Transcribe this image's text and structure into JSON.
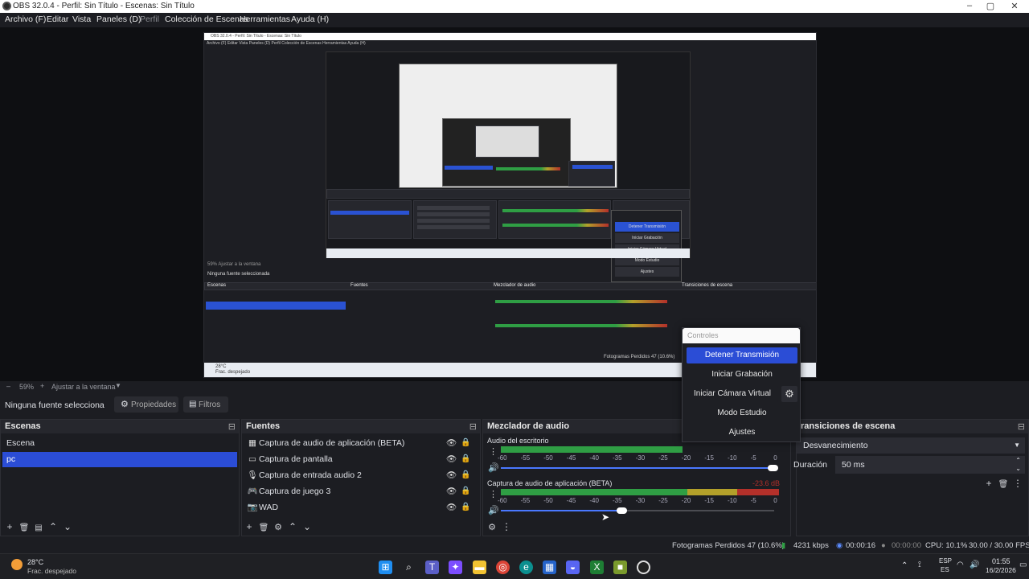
{
  "window": {
    "title": "OBS 32.0.4 - Perfil: Sin Título - Escenas: Sin Título",
    "controls": [
      "–",
      "▢",
      "✕"
    ]
  },
  "menu": [
    {
      "label": "Archivo (F)",
      "dim": false
    },
    {
      "label": "Editar",
      "dim": false
    },
    {
      "label": "Vista",
      "dim": false
    },
    {
      "label": "Paneles (D)",
      "dim": false
    },
    {
      "label": "Perfil",
      "dim": true
    },
    {
      "label": "Colección de Escenas",
      "dim": false
    },
    {
      "label": "Herramientas",
      "dim": false
    },
    {
      "label": "Ayuda (H)",
      "dim": false
    }
  ],
  "preview": {
    "nested_title": "OBS 32.0.4 - Perfil: Sin Título - Escenas: Sin Título",
    "nested_menu": "Archivo (F)   Editar   Vista   Paneles (D)   Perfil   Colección de Escenas   Herramientas   Ayuda (H)",
    "nested_status_left": "Ninguna fuente seleccionada",
    "nested_zoom": "59%   Ajustar a la ventana",
    "nested_scene_head": "Escenas",
    "nested_sources_head": "Fuentes",
    "nested_mixer_head": "Mezclador de audio",
    "nested_trans_head": "Transiciones de escena",
    "nested_weather_temp": "28°C",
    "nested_weather_desc": "Frac. despejado",
    "nested_dropped": "Fotogramas Perdidos 47 (10.6%)",
    "nested_controls": [
      "Detener Transmisión",
      "Iniciar Grabación",
      "Iniciar Cámara Virtual",
      "Modo Estudio",
      "Ajustes"
    ]
  },
  "zoom": {
    "minus": "–",
    "value": "59%",
    "plus": "+",
    "fit": "Ajustar a la ventana"
  },
  "source_toolbar": {
    "no_selection": "Ninguna fuente selecciona",
    "properties": "Propiedades",
    "filters": "Filtros"
  },
  "scenes": {
    "title": "Escenas",
    "items": [
      {
        "name": "Escena",
        "selected": false
      },
      {
        "name": "pc",
        "selected": true
      }
    ]
  },
  "sources": {
    "title": "Fuentes",
    "items": [
      {
        "icon": "app-audio-icon",
        "glyph": "▦",
        "name": "Captura de audio de aplicación (BETA)"
      },
      {
        "icon": "monitor-icon",
        "glyph": "▭",
        "name": "Captura de pantalla"
      },
      {
        "icon": "microphone-icon",
        "glyph": "🎙",
        "name": "Captura de entrada audio 2"
      },
      {
        "icon": "gamepad-icon",
        "glyph": "🎮",
        "name": "Captura de juego 3"
      },
      {
        "icon": "camera-icon",
        "glyph": "📷",
        "name": "WAD"
      }
    ]
  },
  "mixer": {
    "title": "Mezclador de audio",
    "channels": [
      {
        "name": "Audio del escritorio",
        "db": "",
        "volume": 1.0
      },
      {
        "name": "Captura de audio de aplicación (BETA)",
        "db": "-23.6 dB",
        "volume": 0.53
      }
    ],
    "ticks": [
      "-60",
      "-55",
      "-50",
      "-45",
      "-40",
      "-35",
      "-30",
      "-25",
      "-20",
      "-15",
      "-10",
      "-5",
      "0"
    ]
  },
  "controls": {
    "title": "Controles",
    "buttons": [
      "Detener Transmisión",
      "Iniciar Grabación",
      "Iniciar Cámara Virtual",
      "Modo Estudio",
      "Ajustes"
    ]
  },
  "transitions": {
    "title": "ransiciones de escena",
    "selected": "Desvanecimiento",
    "duration_label": "Duración",
    "duration_value": "50 ms"
  },
  "status": {
    "dropped": "Fotogramas Perdidos 47 (10.6%)",
    "bitrate": "4231 kbps",
    "stream_time": "00:00:16",
    "rec_time": "00:00:00",
    "cpu": "CPU: 10.1%",
    "fps": "30.00 / 30.00 FPS"
  },
  "taskbar": {
    "weather_temp": "28°C",
    "weather_desc": "Frac. despejado",
    "lang_top": "ESP",
    "lang_bottom": "ES",
    "time": "01:55",
    "date": "16/2/2026"
  },
  "colors": {
    "accent": "#2b4dd6",
    "background": "#1c1d22",
    "panel_header": "#26272d",
    "meter_green": "#2f9e44",
    "meter_yellow": "#b3a02a",
    "meter_red": "#b3302a"
  }
}
